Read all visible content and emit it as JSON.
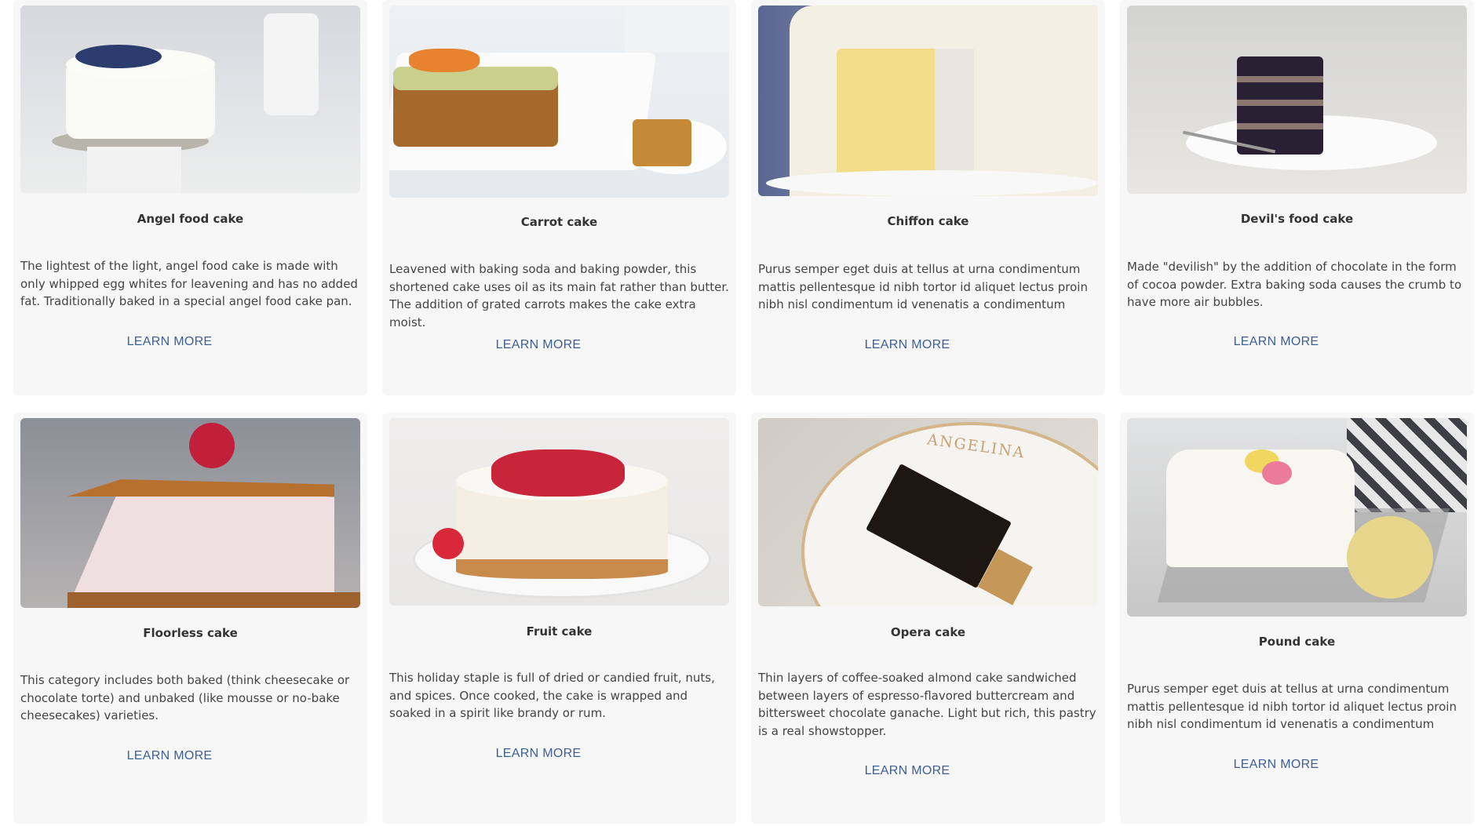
{
  "cards": [
    {
      "title": "Angel food cake",
      "description": "The lightest of the light, angel food cake is made with only whipped egg whites for leavening and has no added fat. Traditionally baked in a special angel food cake pan.",
      "link": "LEARN MORE"
    },
    {
      "title": "Carrot cake",
      "description": "Leavened with baking soda and baking powder, this shortened cake uses oil as its main fat rather than butter. The addition of grated carrots makes the cake extra moist.",
      "link": "LEARN MORE"
    },
    {
      "title": "Chiffon cake",
      "description": "Purus semper eget duis at tellus at urna condimentum mattis pellentesque id nibh tortor id aliquet lectus proin nibh nisl condimentum id venenatis a condimentum",
      "link": "LEARN MORE"
    },
    {
      "title": "Devil's food cake",
      "description": "Made \"devilish\" by the addition of chocolate in the form of cocoa powder. Extra baking soda causes the crumb to have more air bubbles.",
      "link": "LEARN MORE"
    },
    {
      "title": "Floorless cake",
      "description": "This category includes both baked (think cheesecake or chocolate torte) and unbaked (like mousse or no-bake cheesecakes) varieties.",
      "link": "LEARN MORE"
    },
    {
      "title": "Fruit cake",
      "description": "This holiday staple is full of dried or candied fruit, nuts, and spices. Once cooked, the cake is wrapped and soaked in a spirit like brandy or rum.",
      "link": "LEARN MORE"
    },
    {
      "title": "Opera cake",
      "description": "Thin layers of coffee-soaked almond cake sandwiched between layers of espresso-flavored buttercream and bittersweet chocolate ganache. Light but rich, this pastry is a real showstopper.",
      "link": "LEARN MORE"
    },
    {
      "title": "Pound cake",
      "description": "Purus semper eget duis at tellus at urna condimentum mattis pellentesque id nibh tortor id aliquet lectus proin nibh nisl condimentum id venenatis a condimentum",
      "link": "LEARN MORE"
    }
  ],
  "images": [
    {
      "plate_text": ""
    },
    {
      "plate_text": ""
    },
    {
      "plate_text": ""
    },
    {
      "plate_text": ""
    },
    {
      "plate_text": ""
    },
    {
      "plate_text": ""
    },
    {
      "plate_text": "ANGELINA"
    },
    {
      "plate_text": ""
    }
  ]
}
